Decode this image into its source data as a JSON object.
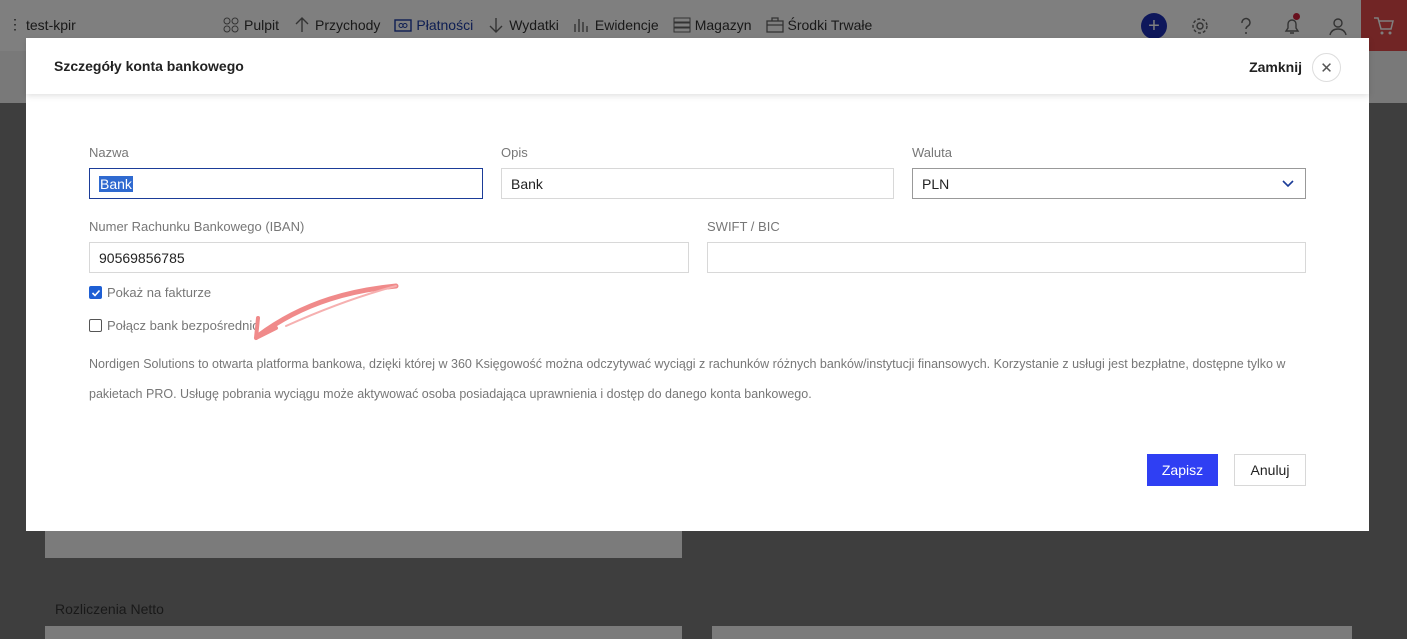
{
  "topbar": {
    "app_name": "test-kpir",
    "nav": [
      {
        "label": "Pulpit",
        "icon": "dashboard-icon"
      },
      {
        "label": "Przychody",
        "icon": "arrow-up-icon"
      },
      {
        "label": "Płatności",
        "icon": "payment-icon"
      },
      {
        "label": "Wydatki",
        "icon": "arrow-down-icon"
      },
      {
        "label": "Ewidencje",
        "icon": "chart-icon"
      },
      {
        "label": "Magazyn",
        "icon": "warehouse-icon"
      },
      {
        "label": "Środki Trwałe",
        "icon": "briefcase-icon"
      }
    ]
  },
  "background": {
    "section_label": "Rozliczenia Netto"
  },
  "modal": {
    "title": "Szczegóły konta bankowego",
    "close_label": "Zamknij",
    "fields": {
      "name_label": "Nazwa",
      "name_value": "Bank",
      "description_label": "Opis",
      "description_value": "Bank",
      "currency_label": "Waluta",
      "currency_value": "PLN",
      "iban_label": "Numer Rachunku Bankowego (IBAN)",
      "iban_value": "90569856785",
      "swift_label": "SWIFT / BIC",
      "swift_value": ""
    },
    "show_on_invoice_label": "Pokaż na fakturze",
    "show_on_invoice_checked": true,
    "connect_bank_label": "Połącz bank bezpośrednio",
    "connect_bank_checked": false,
    "info_text": "Nordigen Solutions to otwarta platforma bankowa, dzięki której w 360 Księgowość można odczytywać wyciągi z rachunków różnych banków/instytucji finansowych. Korzystanie z usługi jest bezpłatne, dostępne tylko w pakietach PRO. Usługę pobrania wyciągu może aktywować osoba posiadająca uprawnienia i dostęp do danego konta bankowego.",
    "save_label": "Zapisz",
    "cancel_label": "Anuluj"
  },
  "colors": {
    "primary": "#2f3ff3",
    "accent_red": "#e34b4b",
    "annotation_arrow": "#f08a8a"
  }
}
